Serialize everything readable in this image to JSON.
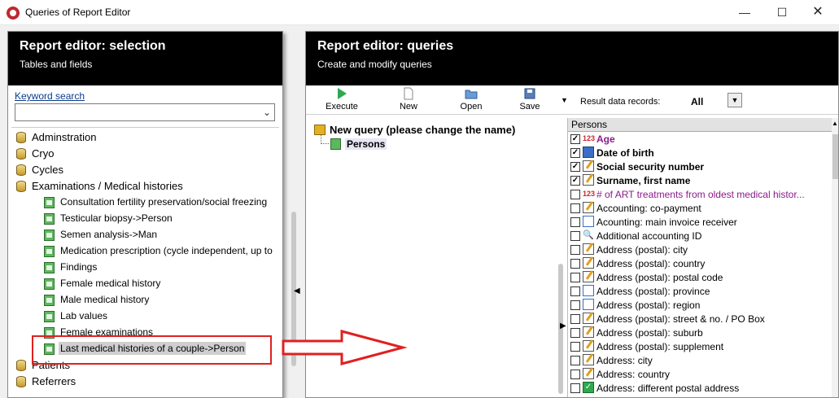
{
  "window": {
    "title": "Queries of Report Editor",
    "minimize": "—",
    "maximize": "☐",
    "close": "✕"
  },
  "left": {
    "title": "Report editor: selection",
    "subtitle": "Tables and fields",
    "keyword_label": "Keyword search",
    "keyword_value": "",
    "tree": [
      {
        "label": "Adminstration",
        "level": 0,
        "icon": "database-icon"
      },
      {
        "label": "Cryo",
        "level": 0,
        "icon": "database-icon"
      },
      {
        "label": "Cycles",
        "level": 0,
        "icon": "database-icon"
      },
      {
        "label": "Examinations / Medical histories",
        "level": 0,
        "icon": "database-icon"
      },
      {
        "label": "Consultation fertility preservation/social freezing",
        "level": 1,
        "icon": "table-icon"
      },
      {
        "label": "Testicular biopsy->Person",
        "level": 1,
        "icon": "table-icon"
      },
      {
        "label": "Semen analysis->Man",
        "level": 1,
        "icon": "table-icon"
      },
      {
        "label": "Medication prescription (cycle independent, up to",
        "level": 1,
        "icon": "table-icon"
      },
      {
        "label": "Findings",
        "level": 1,
        "icon": "table-icon"
      },
      {
        "label": "Female medical history",
        "level": 1,
        "icon": "table-icon"
      },
      {
        "label": "Male medical history",
        "level": 1,
        "icon": "table-icon"
      },
      {
        "label": "Lab values",
        "level": 1,
        "icon": "table-icon"
      },
      {
        "label": "Female examinations",
        "level": 1,
        "icon": "table-icon"
      },
      {
        "label": "Last medical histories of a couple->Person",
        "level": 1,
        "icon": "table-icon",
        "selected": true
      },
      {
        "label": "Patients",
        "level": 0,
        "icon": "database-icon"
      },
      {
        "label": "Referrers",
        "level": 0,
        "icon": "database-icon"
      }
    ]
  },
  "right": {
    "title": "Report editor: queries",
    "subtitle": "Create and modify queries",
    "toolbar": {
      "execute": "Execute",
      "new": "New",
      "open": "Open",
      "save": "Save",
      "result_label": "Result data records:",
      "result_value": "All"
    },
    "query": {
      "name": "New query (please change the name)",
      "child": "Persons"
    },
    "fields_header": "Persons",
    "fields": [
      {
        "label": "Age",
        "checked": true,
        "bold": true,
        "style": "p",
        "icon": "number"
      },
      {
        "label": "Date of birth",
        "checked": true,
        "bold": true,
        "icon": "date"
      },
      {
        "label": "Social security number",
        "checked": true,
        "bold": true,
        "icon": "text"
      },
      {
        "label": "Surname, first name",
        "checked": true,
        "bold": true,
        "icon": "text"
      },
      {
        "label": "# of ART treatments from oldest medical histor...",
        "checked": false,
        "style": "p",
        "icon": "number"
      },
      {
        "label": "Accounting: co-payment",
        "checked": false,
        "icon": "text"
      },
      {
        "label": "Acounting: main invoice receiver",
        "checked": false,
        "icon": "list"
      },
      {
        "label": "Additional accounting ID",
        "checked": false,
        "icon": "key"
      },
      {
        "label": "Address (postal): city",
        "checked": false,
        "icon": "text"
      },
      {
        "label": "Address (postal): country",
        "checked": false,
        "icon": "text"
      },
      {
        "label": "Address (postal): postal code",
        "checked": false,
        "icon": "text"
      },
      {
        "label": "Address (postal): province",
        "checked": false,
        "icon": "list"
      },
      {
        "label": "Address (postal): region",
        "checked": false,
        "icon": "list"
      },
      {
        "label": "Address (postal): street & no. / PO Box",
        "checked": false,
        "icon": "text"
      },
      {
        "label": "Address (postal): suburb",
        "checked": false,
        "icon": "text"
      },
      {
        "label": "Address (postal): supplement",
        "checked": false,
        "icon": "text"
      },
      {
        "label": "Address: city",
        "checked": false,
        "icon": "text"
      },
      {
        "label": "Address: country",
        "checked": false,
        "icon": "text"
      },
      {
        "label": "Address: different postal address",
        "checked": false,
        "icon": "bool"
      }
    ]
  },
  "colors": {
    "header_bg": "#000000",
    "highlight": "#e02020",
    "accent_link": "#0c3b8c"
  }
}
